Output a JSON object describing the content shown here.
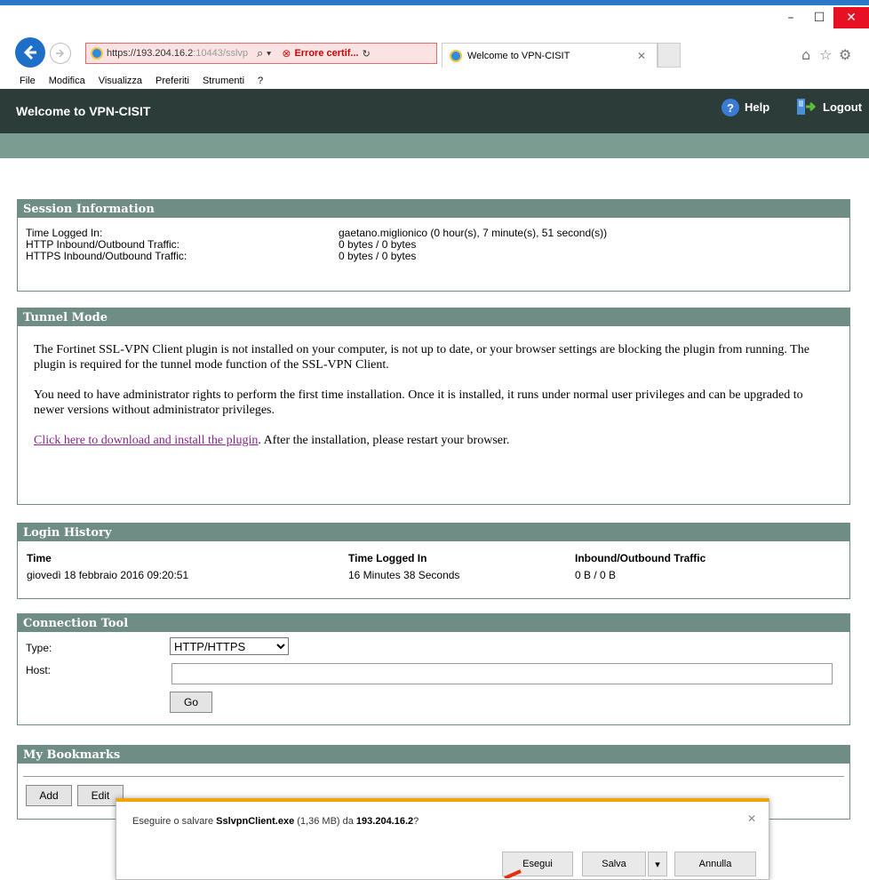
{
  "browser": {
    "url_main": "https://193.204.16.2",
    "url_rest": ":10443/sslvp",
    "search_glyph": "⌕ ▾",
    "cert_error": "Errore certif...",
    "tab_title": "Welcome to VPN-CISIT",
    "menu": [
      "File",
      "Modifica",
      "Visualizza",
      "Preferiti",
      "Strumenti",
      "?"
    ]
  },
  "header": {
    "title": "Welcome to VPN-CISIT",
    "help": "Help",
    "logout": "Logout"
  },
  "session": {
    "title": "Session Information",
    "rows": [
      {
        "label": "Time Logged In:",
        "value": "gaetano.miglionico (0 hour(s), 7 minute(s), 51 second(s))"
      },
      {
        "label": "HTTP Inbound/Outbound Traffic:",
        "value": "0 bytes / 0 bytes"
      },
      {
        "label": "HTTPS Inbound/Outbound Traffic:",
        "value": "0 bytes / 0 bytes"
      }
    ]
  },
  "tunnel": {
    "title": "Tunnel Mode",
    "para1": "The Fortinet SSL-VPN Client plugin is not installed on your computer, is not up to date, or your browser settings are blocking the plugin from running. The plugin is required for the tunnel mode function of the SSL-VPN Client.",
    "para2": "You need to have administrator rights to perform the first time installation. Once it is installed, it runs under normal user privileges and can be upgraded to newer versions without administrator privileges.",
    "link": "Click here to download and install the plugin",
    "after_link": ". After the installation, please restart your browser."
  },
  "history": {
    "title": "Login History",
    "headers": [
      "Time",
      "Time Logged In",
      "Inbound/Outbound Traffic"
    ],
    "row": [
      "giovedì 18 febbraio 2016 09:20:51",
      "16 Minutes 38 Seconds",
      "0 B / 0 B"
    ]
  },
  "tool": {
    "title": "Connection Tool",
    "type_label": "Type:",
    "type_value": "HTTP/HTTPS",
    "host_label": "Host:",
    "host_value": "",
    "go": "Go"
  },
  "bookmarks": {
    "title": "My Bookmarks",
    "add": "Add",
    "edit": "Edit"
  },
  "download": {
    "prefix": "Eseguire o salvare ",
    "file": "SslvpnClient.exe",
    "size": " (1,36 MB) da ",
    "host": "193.204.16.2",
    "suffix": "?",
    "run": "Esegui",
    "save": "Salva",
    "cancel": "Annulla"
  },
  "colors": {
    "panel_header": "#6f8d85",
    "page_header": "#2c3c38",
    "accent_band": "#7b9c90",
    "cert_error": "#c00000",
    "dialog_accent": "#f0a40a"
  }
}
